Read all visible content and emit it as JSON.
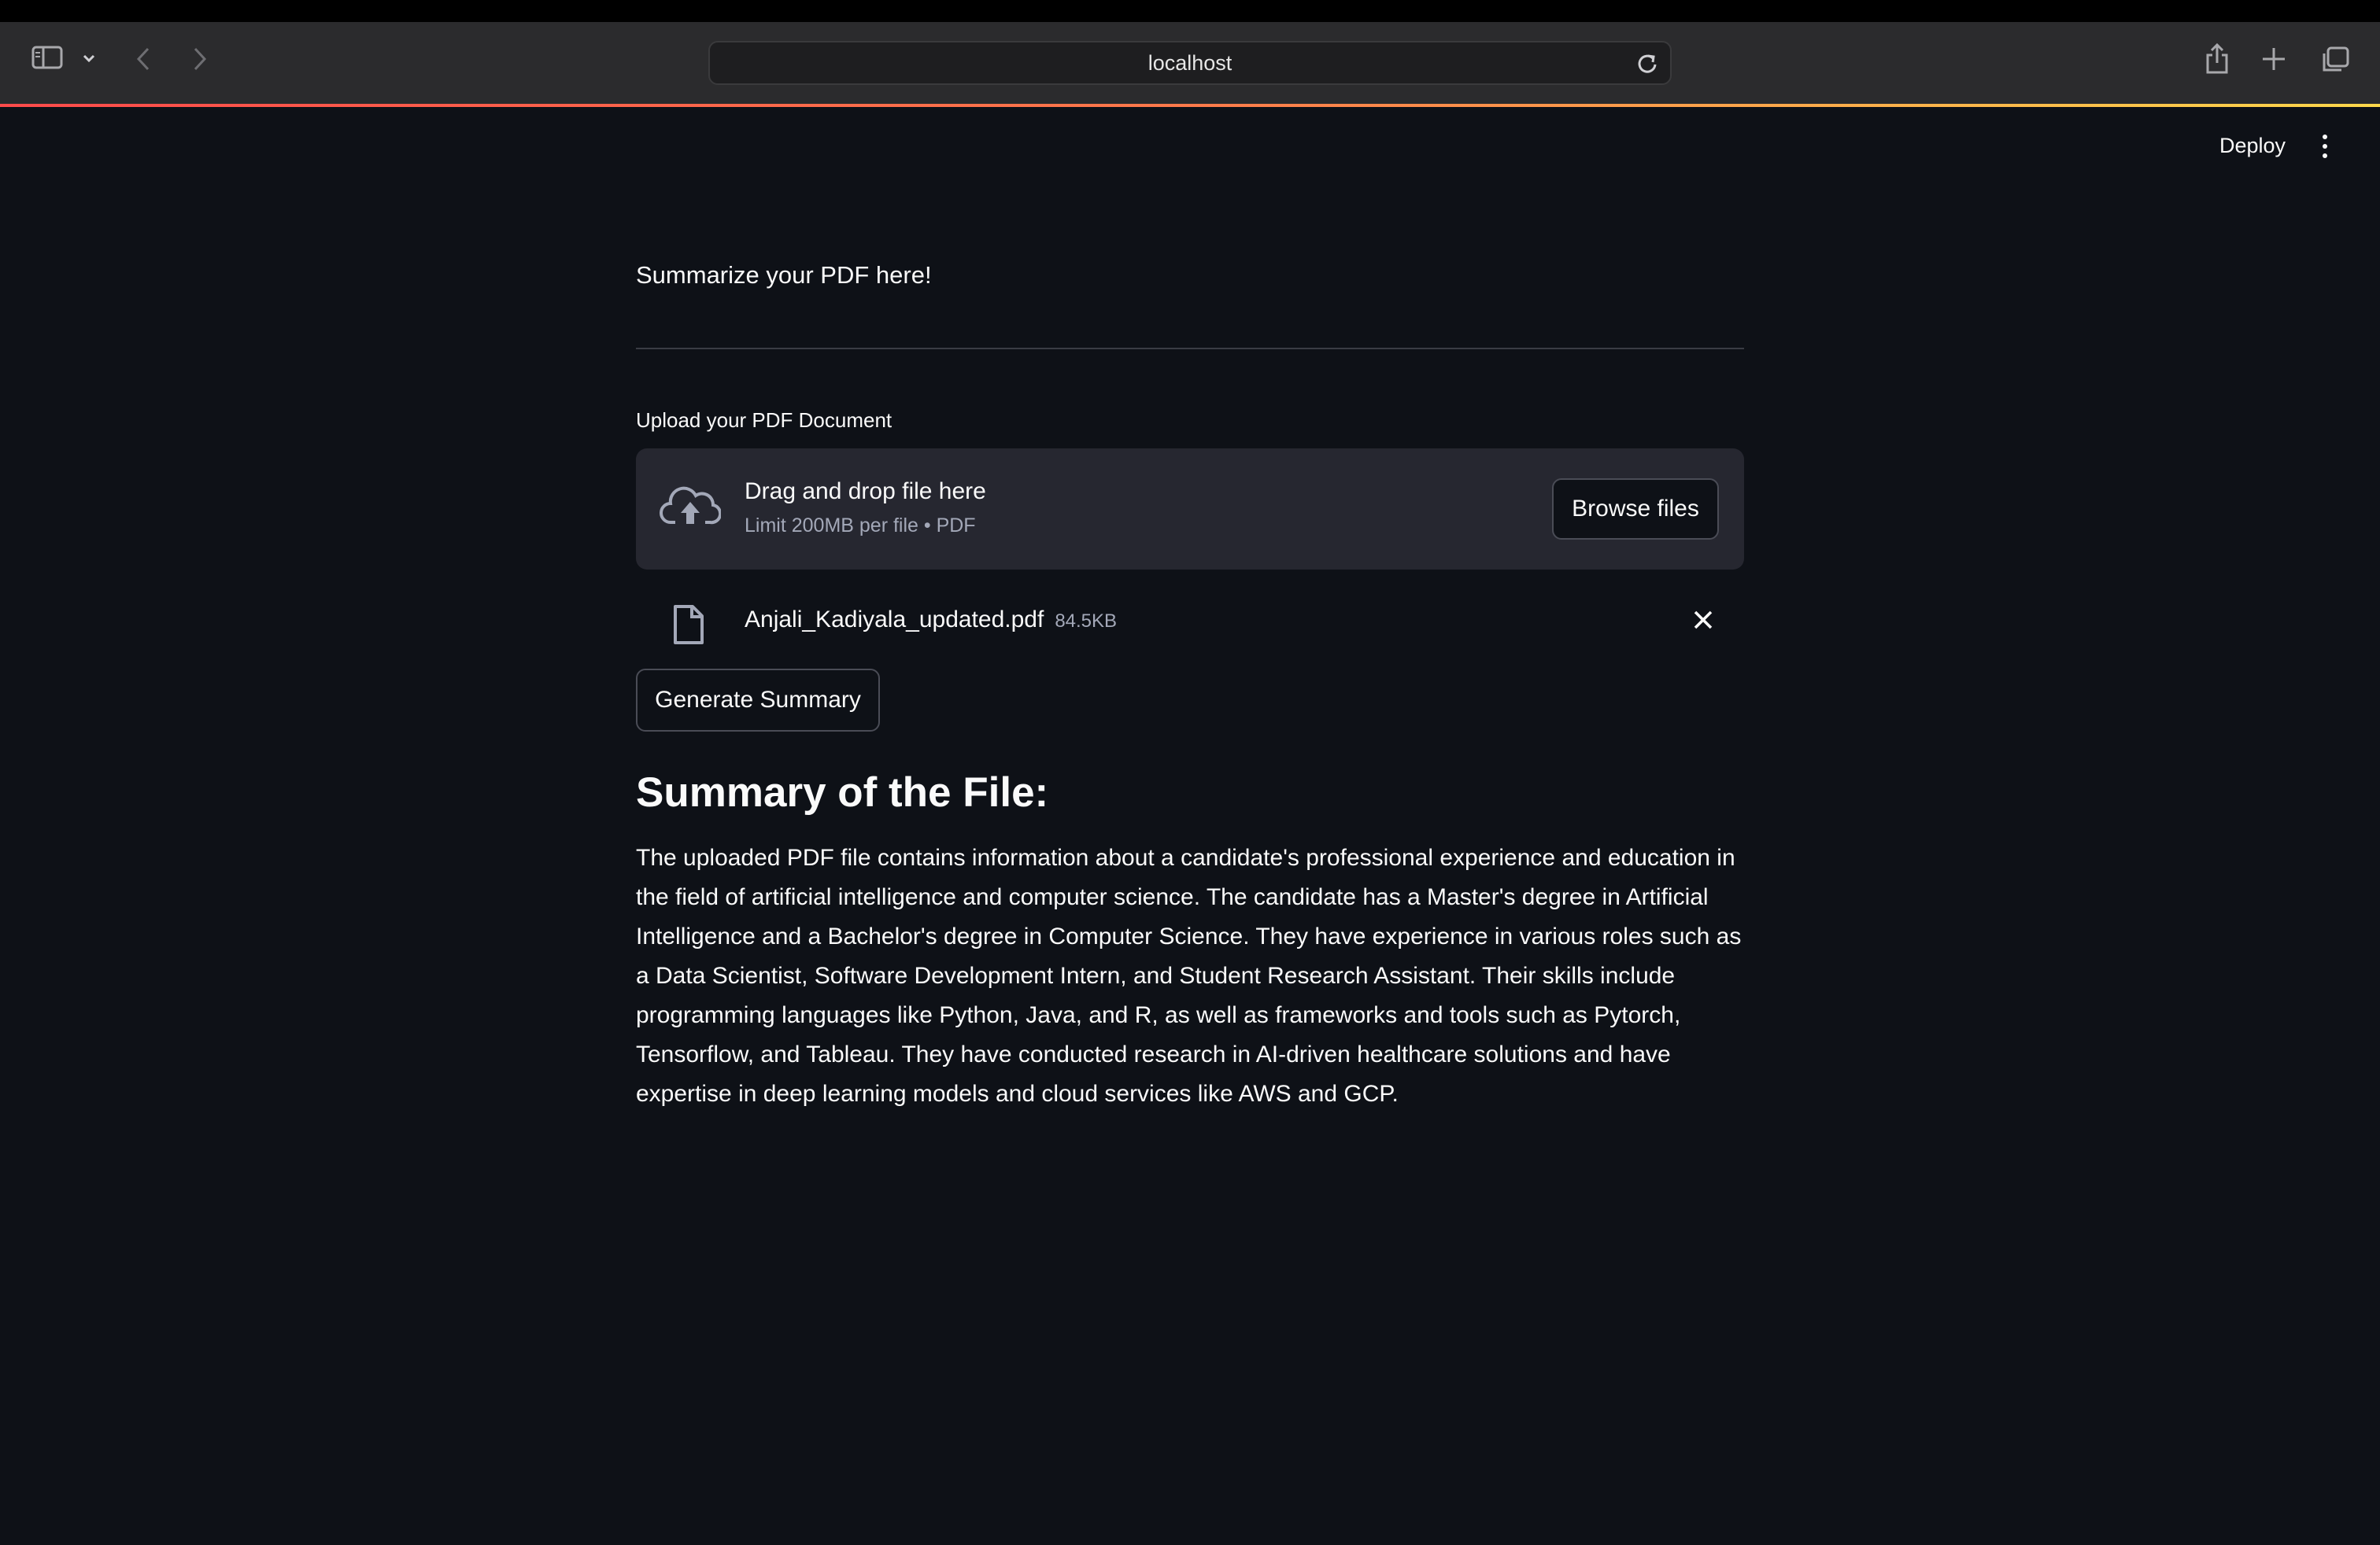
{
  "browser": {
    "url": "localhost"
  },
  "app_header": {
    "deploy_label": "Deploy"
  },
  "main": {
    "intro_text": "Summarize your PDF here!",
    "uploader": {
      "label": "Upload your PDF Document",
      "drop_title": "Drag and drop file here",
      "drop_subtitle": "Limit 200MB per file • PDF",
      "browse_label": "Browse files"
    },
    "uploaded_file": {
      "name": "Anjali_Kadiyala_updated.pdf",
      "size": "84.5KB"
    },
    "generate_label": "Generate Summary",
    "summary_heading": "Summary of the File:",
    "summary_text": "The uploaded PDF file contains information about a candidate's professional experience and education in the field of artificial intelligence and computer science. The candidate has a Master's degree in Artificial Intelligence and a Bachelor's degree in Computer Science. They have experience in various roles such as a Data Scientist, Software Development Intern, and Student Research Assistant. Their skills include programming languages like Python, Java, and R, as well as frameworks and tools such as Pytorch, Tensorflow, and Tableau. They have conducted research in AI-driven healthcare solutions and have expertise in deep learning models and cloud services like AWS and GCP."
  },
  "icons": {
    "sidebar": "sidebar-icon",
    "chevron_down": "chevron-down-icon",
    "back": "back-arrow-icon",
    "forward": "forward-arrow-icon",
    "reload": "reload-icon",
    "share": "share-icon",
    "new_tab": "plus-icon",
    "tabs": "tab-overview-icon",
    "more": "more-vertical-icon",
    "cloud_upload": "cloud-upload-icon",
    "file": "file-icon",
    "close": "close-icon"
  },
  "colors": {
    "background": "#0e1117",
    "dropzone": "#262730",
    "accent_gradient": [
      "#ff4b4b",
      "#ffd84b"
    ]
  }
}
